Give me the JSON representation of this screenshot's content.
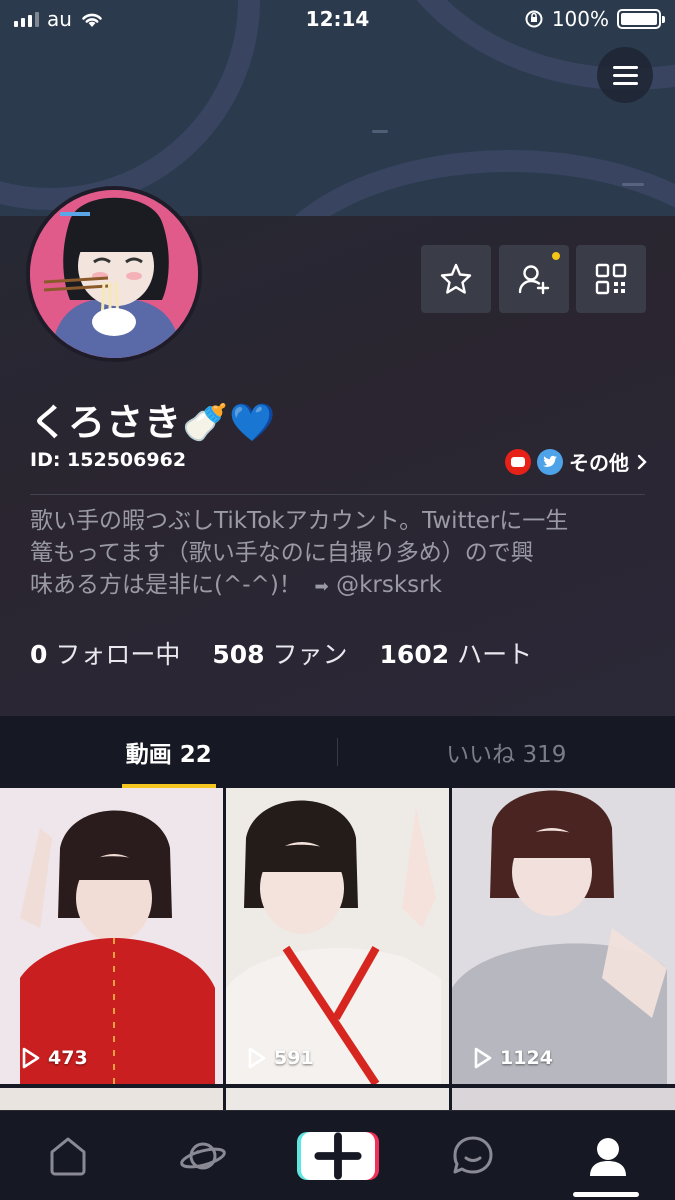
{
  "status_bar": {
    "carrier": "au",
    "time": "12:14",
    "battery_percent": "100%"
  },
  "profile": {
    "display_name": "くろさき🍼💙",
    "user_id": "ID: 152506962",
    "links_label": "その他",
    "bio_line1": "歌い手の暇つぶしTikTokアカウント。Twitterに一生",
    "bio_line2": "篭もってます（歌い手なのに自撮り多め）ので興",
    "bio_line3": "味ある方は是非に(^-^)！",
    "bio_handle": "@krsksrk",
    "stats": {
      "following_count": "0",
      "following_label": "フォロー中",
      "fans_count": "508",
      "fans_label": "ファン",
      "hearts_count": "1602",
      "hearts_label": "ハート"
    }
  },
  "tabs": {
    "videos": "動画 22",
    "likes": "いいね 319"
  },
  "videos": [
    {
      "views": "473",
      "palette": [
        "#efe6ea",
        "#c91f20",
        "#2a1c1c"
      ]
    },
    {
      "views": "591",
      "palette": [
        "#f1ece7",
        "#d6261f",
        "#241c18"
      ]
    },
    {
      "views": "1124",
      "palette": [
        "#dfdde0",
        "#b7b8bf",
        "#4a2420"
      ]
    }
  ],
  "colors": {
    "accent_underline": "#f4c61f",
    "notification_dot": "#f5c518",
    "youtube": "#e62117",
    "twitter": "#4ea3e8"
  }
}
